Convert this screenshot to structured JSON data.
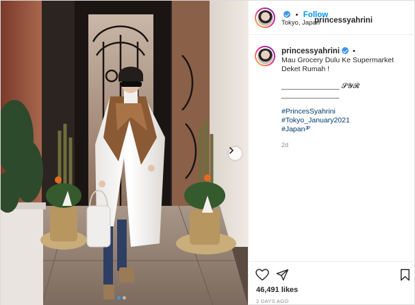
{
  "post": {
    "author": "princessyahrini",
    "follow_label": "Follow",
    "dot": "•",
    "location": "Tokyo, Japan",
    "caption": {
      "line1": "Mau Grocery Dulu Ke Supermarket",
      "line2": "Deket Rumah !",
      "signature": "______________ 𝓢𝓨𝓡 ______________",
      "hashtags": [
        "#PrincesSyahrini",
        "#Tokyo_January2021",
        "#Japanᴶᴾ"
      ],
      "age": "2d"
    },
    "likes": "46,491 likes",
    "timestamp": "2 DAYS AGO",
    "carousel": {
      "count": 2,
      "active_index": 0
    }
  },
  "icons": {
    "verified": "verified-badge-icon",
    "like": "heart-icon",
    "share": "paper-plane-icon",
    "save": "bookmark-icon",
    "next": "chevron-right-icon"
  },
  "colors": {
    "link": "#0095f6",
    "hashtag": "#00376b",
    "muted": "#8e8e8e",
    "verified": "#3897f0"
  }
}
